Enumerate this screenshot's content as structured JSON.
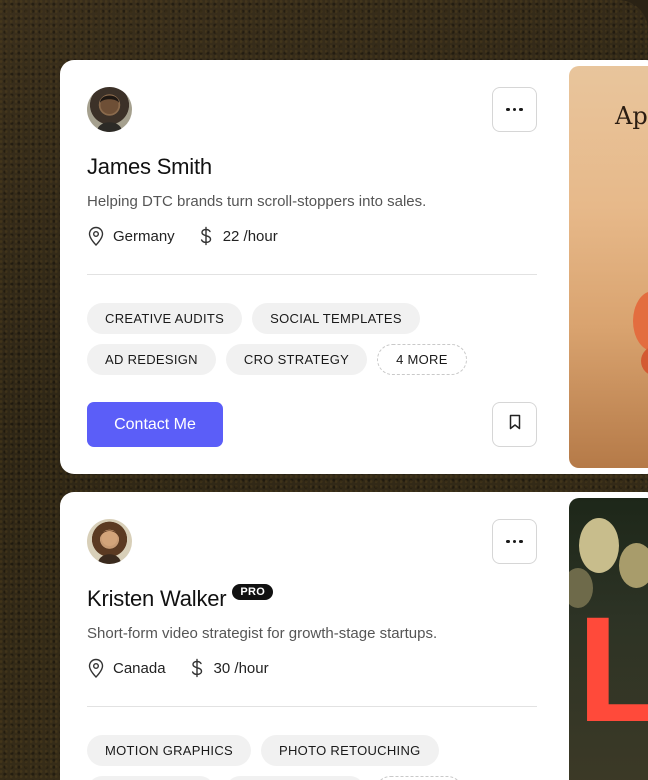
{
  "profiles": [
    {
      "name": "James Smith",
      "badge": "",
      "tagline": "Helping DTC brands turn scroll-stoppers into sales.",
      "location": "Germany",
      "rate": "22 /hour",
      "tags_row1": [
        "CREATIVE AUDITS",
        "SOCIAL TEMPLATES"
      ],
      "tags_row2": [
        "AD REDESIGN",
        "CRO STRATEGY"
      ],
      "more_tag": "4 MORE",
      "contact_label": "Contact Me",
      "preview_text": "Ap"
    },
    {
      "name": "Kristen Walker",
      "badge": "PRO",
      "tagline": "Short-form video strategist for growth-stage startups.",
      "location": "Canada",
      "rate": "30 /hour",
      "tags_row1": [
        "MOTION GRAPHICS",
        "PHOTO RETOUCHING"
      ],
      "preview_text": "LO"
    }
  ],
  "colors": {
    "accent": "#5b5ef8",
    "card": "#ffffff",
    "tag_bg": "#f1f1f1",
    "background": "#2a2214"
  },
  "icons": {
    "more": "more-horizontal-icon",
    "location": "map-pin-icon",
    "rate": "dollar-icon",
    "bookmark": "bookmark-icon"
  }
}
